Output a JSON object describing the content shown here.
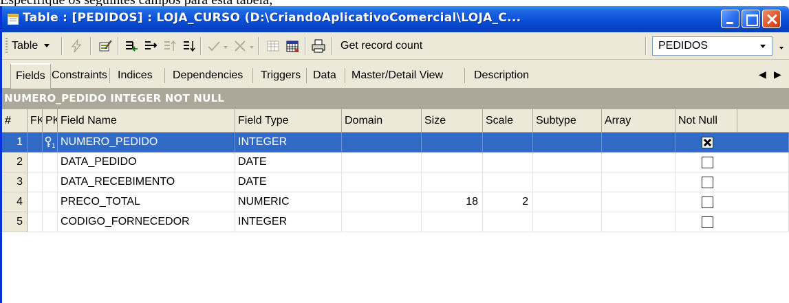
{
  "caption": "Especifique os seguintes campos para esta tabela;",
  "window": {
    "title": "Table : [PEDIDOS] : LOJA_CURSO (D:\\CriandoAplicativoComercial\\LOJA_C..."
  },
  "toolbar": {
    "table_menu": "Table",
    "get_record_count": "Get record count",
    "table_selector_value": "PEDIDOS",
    "icons": [
      "lightning-icon",
      "edit-icon",
      "insert-field-icon",
      "add-field-icon",
      "move-up-icon",
      "move-down-icon",
      "commit-icon",
      "rollback-icon",
      "grid-icon",
      "calendar-icon",
      "print-icon"
    ]
  },
  "tabs": [
    {
      "label": "Fields",
      "active": true
    },
    {
      "label": "Constraints"
    },
    {
      "label": "Indices"
    },
    {
      "label": "Dependencies"
    },
    {
      "label": "Triggers"
    },
    {
      "label": "Data"
    },
    {
      "label": "Master/Detail View"
    },
    {
      "label": "Description"
    }
  ],
  "field_description": "NUMERO_PEDIDO INTEGER NOT NULL",
  "grid": {
    "columns": [
      "#",
      "FK",
      "PK",
      "Field Name",
      "Field Type",
      "Domain",
      "Size",
      "Scale",
      "Subtype",
      "Array",
      "Not Null"
    ],
    "rows": [
      {
        "n": "1",
        "fk": "",
        "pk": "key",
        "name": "NUMERO_PEDIDO",
        "type": "INTEGER",
        "domain": "",
        "size": "",
        "scale": "",
        "subtype": "",
        "array": "",
        "not_null": true,
        "selected": true
      },
      {
        "n": "2",
        "fk": "",
        "pk": "",
        "name": "DATA_PEDIDO",
        "type": "DATE",
        "domain": "",
        "size": "",
        "scale": "",
        "subtype": "",
        "array": "",
        "not_null": false
      },
      {
        "n": "3",
        "fk": "",
        "pk": "",
        "name": "DATA_RECEBIMENTO",
        "type": "DATE",
        "domain": "",
        "size": "",
        "scale": "",
        "subtype": "",
        "array": "",
        "not_null": false
      },
      {
        "n": "4",
        "fk": "",
        "pk": "",
        "name": "PRECO_TOTAL",
        "type": "NUMERIC",
        "domain": "",
        "size": "18",
        "scale": "2",
        "subtype": "",
        "array": "",
        "not_null": false
      },
      {
        "n": "5",
        "fk": "",
        "pk": "",
        "name": "CODIGO_FORNECEDOR",
        "type": "INTEGER",
        "domain": "",
        "size": "",
        "scale": "",
        "subtype": "",
        "array": "",
        "not_null": false
      }
    ]
  },
  "colors": {
    "title_bar": "#0a4fd6",
    "selection": "#316ac5",
    "field_bar": "#aca899",
    "face": "#ece9d8"
  }
}
